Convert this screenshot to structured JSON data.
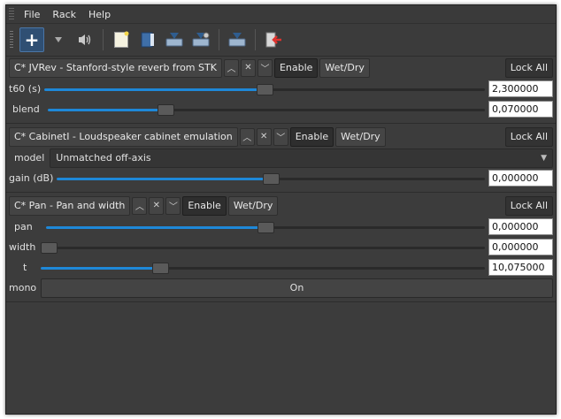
{
  "menubar": {
    "items": [
      "File",
      "Rack",
      "Help"
    ]
  },
  "toolbar": {
    "add_icon": "plus-icon",
    "icons": [
      "add-plugin-icon",
      "dropdown-arrow-icon",
      "speaker-icon",
      "new-rack-icon",
      "open-rack-icon",
      "save-rack-icon",
      "save-as-rack-icon",
      "save-preset-icon",
      "quit-icon"
    ]
  },
  "colors": {
    "accent": "#1e88d8",
    "window": "#3c3c3c"
  },
  "plugins": [
    {
      "name": "C* JVRev - Stanford-style reverb from STK",
      "enable_label": "Enable",
      "wetdry_label": "Wet/Dry",
      "lock_label": "Lock All",
      "controls": [
        {
          "label": "t60 (s)",
          "value": "2,300000",
          "level": 0.5
        },
        {
          "label": "blend",
          "value": "0,070000",
          "level": 0.26
        }
      ]
    },
    {
      "name": "C* CabinetI - Loudspeaker cabinet emulation",
      "enable_label": "Enable",
      "wetdry_label": "Wet/Dry",
      "lock_label": "Lock All",
      "model_label": "model",
      "model_value": "Unmatched off-axis",
      "controls": [
        {
          "label": "gain (dB)",
          "value": "0,000000",
          "level": 0.5
        }
      ]
    },
    {
      "name": "C* Pan - Pan and width",
      "enable_label": "Enable",
      "wetdry_label": "Wet/Dry",
      "lock_label": "Lock All",
      "controls": [
        {
          "label": "pan",
          "value": "0,000000",
          "level": 0.5
        },
        {
          "label": "width",
          "value": "0,000000",
          "level": 0.0
        },
        {
          "label": "t",
          "value": "10,075000",
          "level": 0.26
        }
      ],
      "mono_label": "mono",
      "mono_value": "On"
    }
  ]
}
